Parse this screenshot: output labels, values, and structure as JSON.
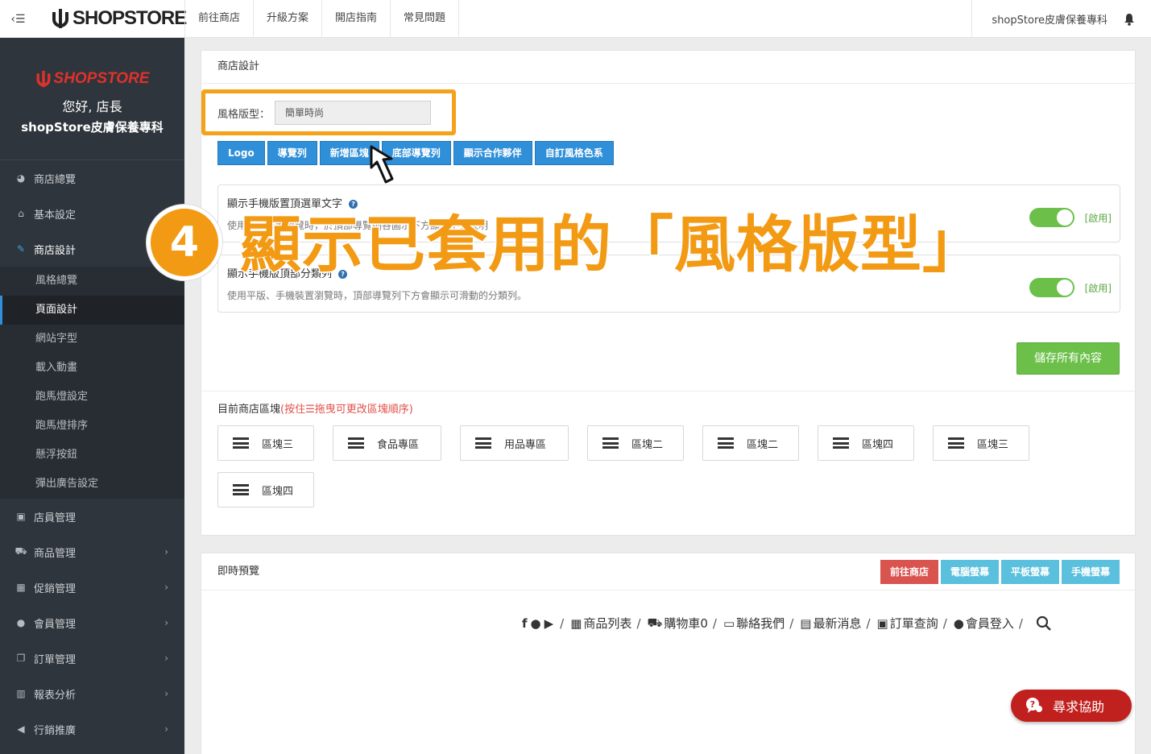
{
  "topbar": {
    "brand": "SHOPSTORE",
    "nav": [
      "前往商店",
      "升級方案",
      "開店指南",
      "常見問題"
    ],
    "store_name": "shopStore皮膚保養專科"
  },
  "sidebar": {
    "brand": "SHOPSTORE",
    "greeting": "您好, 店長",
    "store_name": "shopStore皮膚保養專科",
    "items_top": [
      {
        "label": "商店總覽",
        "icon": "dashboard-icon"
      },
      {
        "label": "基本設定",
        "icon": "bank-icon"
      },
      {
        "label": "商店設計",
        "icon": "brush-icon"
      }
    ],
    "sub_items": [
      "風格總覽",
      "頁面設計",
      "網站字型",
      "載入動畫",
      "跑馬燈設定",
      "跑馬燈排序",
      "懸浮按鈕",
      "彈出廣告設定"
    ],
    "items_bottom": [
      {
        "label": "店員管理",
        "icon": "lock-icon"
      },
      {
        "label": "商品管理",
        "icon": "cart-icon"
      },
      {
        "label": "促銷管理",
        "icon": "gift-icon"
      },
      {
        "label": "會員管理",
        "icon": "users-icon"
      },
      {
        "label": "訂單管理",
        "icon": "copy-icon"
      },
      {
        "label": "報表分析",
        "icon": "bar-chart-icon"
      },
      {
        "label": "行銷推廣",
        "icon": "bullhorn-icon"
      }
    ]
  },
  "design_panel": {
    "title": "商店設計",
    "style_label": "風格版型：",
    "style_value": "簡單時尚",
    "buttons": [
      "Logo",
      "導覽列",
      "新增區塊",
      "底部導覽列",
      "顯示合作夥伴",
      "自訂風格色系"
    ],
    "option1": {
      "title": "顯示手機版置頂選單文字",
      "desc": "使用手機裝置瀏覽時，於頂部導覽列各圖示下方顯示中文說明",
      "toggle_label": "[啟用]"
    },
    "option2": {
      "title": "顯示手機版頂部分類列",
      "desc": "使用平版、手機裝置瀏覽時，頂部導覽列下方會顯示可滑動的分類列。",
      "toggle_label": "[啟用]"
    },
    "save_label": "儲存所有內容",
    "blocks_title": "目前商店區塊",
    "blocks_hint": "(按住☰拖曳可更改區塊順序)",
    "blocks": [
      "區塊三",
      "食品專區",
      "用品專區",
      "區塊二",
      "區塊二",
      "區塊四",
      "區塊三",
      "區塊四"
    ]
  },
  "preview_panel": {
    "title": "即時預覽",
    "buttons": [
      "前往商店",
      "電腦螢幕",
      "平板螢幕",
      "手機螢幕"
    ],
    "nav": [
      "商品列表",
      "購物車0",
      "聯絡我們",
      "最新消息",
      "訂單查詢",
      "會員登入"
    ]
  },
  "annotation": {
    "number": "4",
    "text": "顯示已套用的「風格版型」"
  },
  "help_button": "尋求協助",
  "colors": {
    "accent_blue": "#2f8fd8",
    "highlight_orange": "#f39a14",
    "toggle_green": "#6cc04a",
    "sidebar_bg": "#2f353c"
  }
}
